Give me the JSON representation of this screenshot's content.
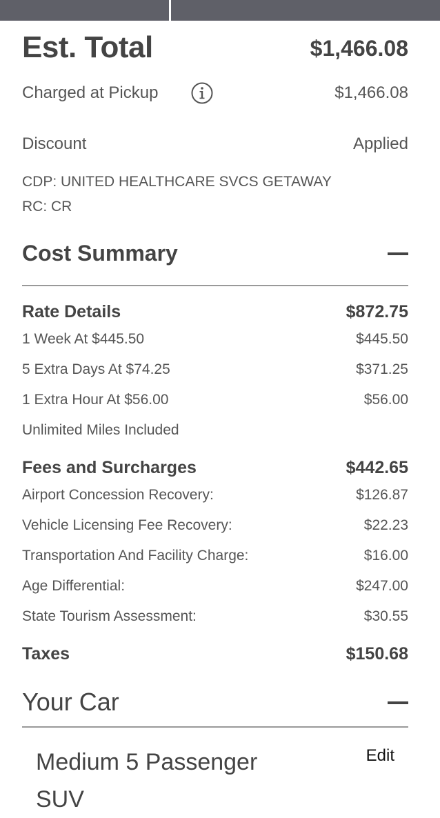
{
  "summary": {
    "est_total_label": "Est. Total",
    "est_total_value": "$1,466.08",
    "charged_label": "Charged at Pickup",
    "charged_value": "$1,466.08",
    "discount_label": "Discount",
    "discount_value": "Applied",
    "cdp_line": "CDP: UNITED HEALTHCARE SVCS GETAWAY",
    "rc_line": "RC: CR"
  },
  "cost_summary": {
    "title": "Cost Summary",
    "rate_details": {
      "label": "Rate Details",
      "total": "$872.75",
      "lines": [
        {
          "label": "1 Week At $445.50",
          "value": "$445.50"
        },
        {
          "label": "5 Extra Days At $74.25",
          "value": "$371.25"
        },
        {
          "label": "1 Extra Hour At $56.00",
          "value": "$56.00"
        },
        {
          "label": "Unlimited Miles Included",
          "value": ""
        }
      ]
    },
    "fees": {
      "label": "Fees and Surcharges",
      "total": "$442.65",
      "lines": [
        {
          "label": "Airport Concession Recovery:",
          "value": "$126.87"
        },
        {
          "label": "Vehicle Licensing Fee Recovery:",
          "value": "$22.23"
        },
        {
          "label": "Transportation And Facility Charge:",
          "value": "$16.00"
        },
        {
          "label": "Age Differential:",
          "value": "$247.00"
        },
        {
          "label": "State Tourism Assessment:",
          "value": "$30.55"
        }
      ]
    },
    "taxes": {
      "label": "Taxes",
      "value": "$150.68"
    }
  },
  "your_car": {
    "title": "Your Car",
    "car_name": "Medium 5 Passenger SUV",
    "edit_label": "Edit"
  },
  "icons": {
    "info": "info-icon",
    "collapse": "minus-icon"
  }
}
